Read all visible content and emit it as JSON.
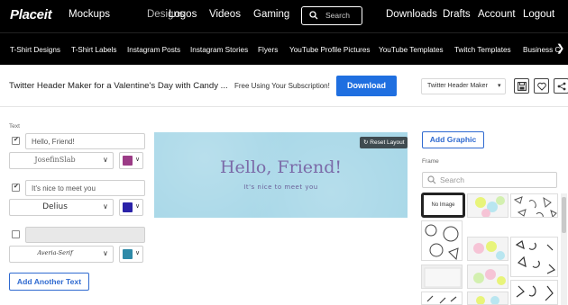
{
  "topnav": {
    "logo": "Placeit",
    "links": [
      "Mockups",
      "Designs",
      "Logos",
      "Videos",
      "Gaming"
    ],
    "search_placeholder": "Search",
    "right_links": [
      "Downloads",
      "Drafts",
      "Account",
      "Logout"
    ]
  },
  "categories": [
    "T-Shirt Designs",
    "T-Shirt Labels",
    "Instagram Posts",
    "Instagram Stories",
    "Flyers",
    "YouTube Profile Pictures",
    "YouTube Templates",
    "Twitch Templates",
    "Business C"
  ],
  "titlebar": {
    "title": "Twitter Header Maker for a Valentine's Day with Candy ...",
    "subscription_text": "Free Using Your Subscription!",
    "download_label": "Download",
    "template_select": "Twitter Header Maker"
  },
  "text_panel": {
    "section_label": "Text",
    "rows": [
      {
        "checked": true,
        "value": "Hello, Friend!",
        "font": "JosefinSlab",
        "color": "#9b3b86"
      },
      {
        "checked": true,
        "value": "It's nice to meet you",
        "font": "Delius",
        "color": "#2a22a8"
      },
      {
        "checked": false,
        "value": "",
        "font": "Averia-Serif",
        "color": "#2f8aa8"
      }
    ],
    "add_text_label": "Add Another Text"
  },
  "canvas": {
    "headline": "Hello, Friend!",
    "subline": "It's nice to meet you",
    "reset_label": "Reset Layout",
    "background": "#a9d8e8"
  },
  "graphics_panel": {
    "add_graphic_label": "Add Graphic",
    "frame_label": "Frame",
    "search_placeholder": "Search",
    "no_image_label": "No Image"
  },
  "colors": {
    "accent": "#1f6fe0",
    "nav_bg": "#000000"
  }
}
